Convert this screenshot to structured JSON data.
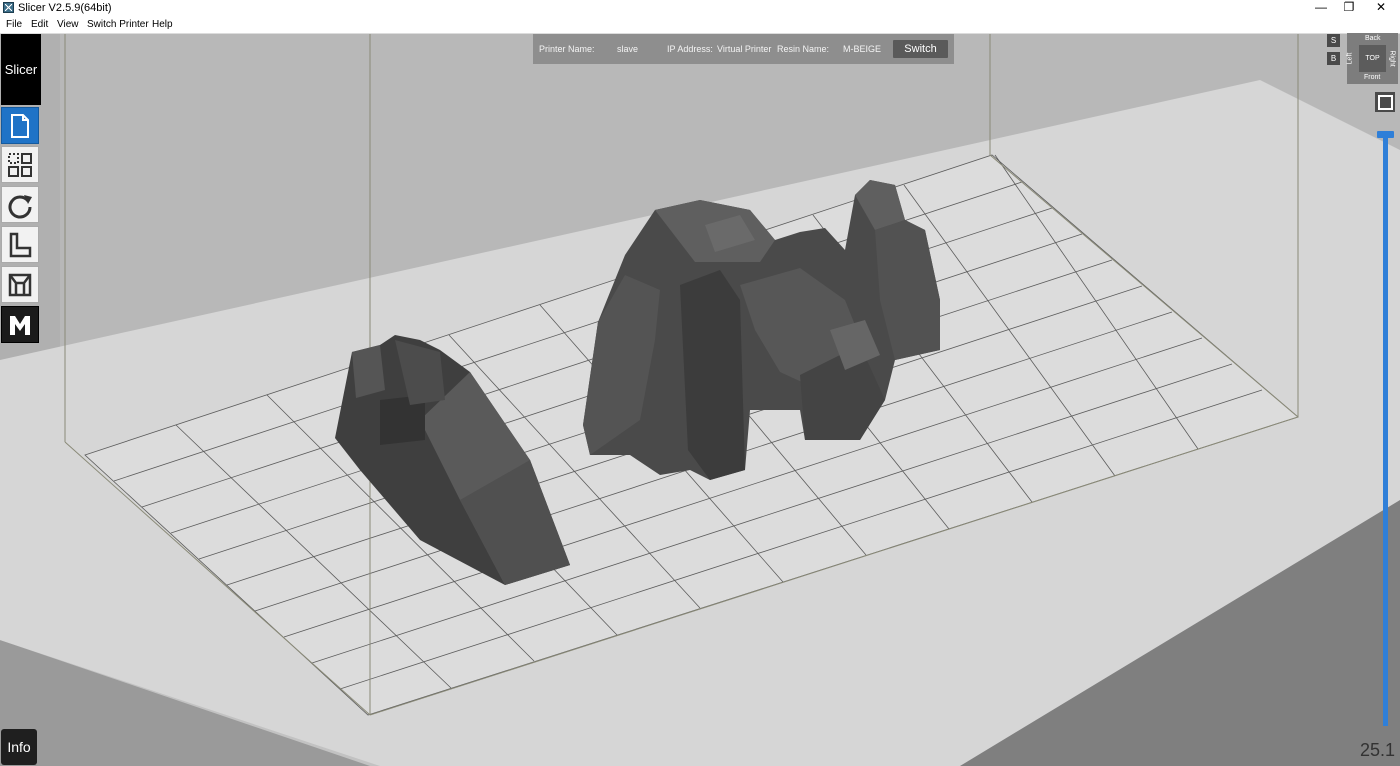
{
  "window": {
    "title": "Slicer V2.5.9(64bit)",
    "controls": {
      "minimize": "—",
      "restore": "❐",
      "close": "✕"
    }
  },
  "menu": [
    "File",
    "Edit",
    "View",
    "Switch Printer",
    "Help"
  ],
  "toolbar": {
    "slicer_label": "Slicer",
    "tools": [
      {
        "name": "file-icon",
        "state": "active"
      },
      {
        "name": "layout-grid-icon",
        "state": "normal"
      },
      {
        "name": "rotate-icon",
        "state": "normal"
      },
      {
        "name": "scale-icon",
        "state": "normal"
      },
      {
        "name": "support-icon",
        "state": "normal"
      },
      {
        "name": "m-icon",
        "state": "dark"
      }
    ],
    "info_label": "Info"
  },
  "printer": {
    "name_label": "Printer Name:",
    "name_value": "slave",
    "ip_label": "IP Address:",
    "ip_value": "Virtual Printer",
    "resin_label": "Resin Name:",
    "resin_value": "M-BEIGE",
    "switch_label": "Switch"
  },
  "view_controls": {
    "s_label": "S",
    "b_label": "B",
    "cube": {
      "top": "TOP",
      "back": "Back",
      "front": "Front",
      "left": "Left",
      "right": "Right"
    }
  },
  "slider": {
    "value_text": "25.1",
    "level": 1.0
  },
  "colors": {
    "accent": "#1f73c7",
    "slider": "#2f7fd8",
    "model": "#4e4e4e",
    "build_plate": "#dadada",
    "background": "#c2c2c2"
  }
}
